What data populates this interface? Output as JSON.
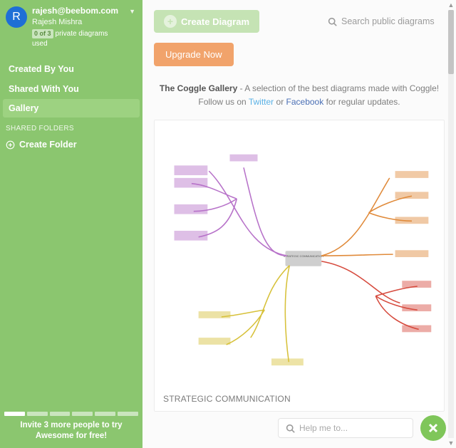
{
  "user": {
    "initial": "R",
    "email": "rajesh@beebom.com",
    "name": "Rajesh Mishra",
    "quota_badge": "0 of 3",
    "quota_text": "private diagrams used"
  },
  "nav": {
    "items": [
      {
        "label": "Created By You",
        "active": false
      },
      {
        "label": "Shared With You",
        "active": false
      },
      {
        "label": "Gallery",
        "active": true
      }
    ]
  },
  "shared_folders_label": "SHARED FOLDERS",
  "create_folder_label": "Create Folder",
  "invite": {
    "line1": "Invite 3 more people to try",
    "line2": "Awesome for free!"
  },
  "toolbar": {
    "create_label": "Create Diagram",
    "search_placeholder": "Search public diagrams",
    "upgrade_label": "Upgrade Now"
  },
  "intro": {
    "strong": "The Coggle Gallery",
    "rest1": " - A selection of the best diagrams made with Coggle!",
    "follow_prefix": "Follow us on ",
    "twitter": "Twitter",
    "or": " or ",
    "facebook": "Facebook",
    "follow_suffix": " for regular updates."
  },
  "gallery": {
    "items": [
      {
        "title": "STRATEGIC COMMUNICATION",
        "center_label": "STRATEGIC COMMUNICATION"
      }
    ]
  },
  "help": {
    "placeholder": "Help me to..."
  }
}
